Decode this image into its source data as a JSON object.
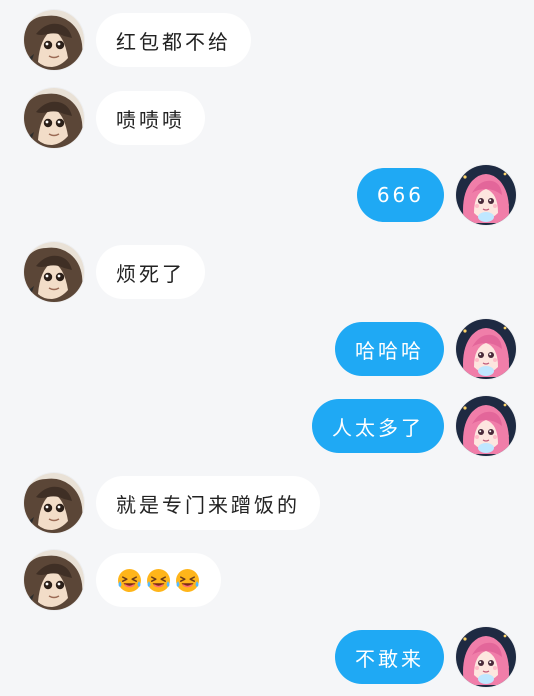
{
  "messages": [
    {
      "side": "left",
      "text": "红包都不给",
      "avatar": "avatar-male"
    },
    {
      "side": "left",
      "text": "啧啧啧",
      "avatar": "avatar-male"
    },
    {
      "side": "right",
      "text": "666",
      "avatar": "avatar-female"
    },
    {
      "side": "left",
      "text": "烦死了",
      "avatar": "avatar-male"
    },
    {
      "side": "right",
      "text": "哈哈哈",
      "avatar": "avatar-female"
    },
    {
      "side": "right",
      "text": "人太多了",
      "avatar": "avatar-female"
    },
    {
      "side": "left",
      "text": "就是专门来蹭饭的",
      "avatar": "avatar-male"
    },
    {
      "side": "left",
      "emoji": [
        "laughing-crying-face-icon",
        "laughing-crying-face-icon",
        "laughing-crying-face-icon"
      ],
      "avatar": "avatar-male"
    },
    {
      "side": "right",
      "text": "不敢来",
      "avatar": "avatar-female"
    }
  ],
  "colors": {
    "background": "#f5f6f8",
    "left_bubble": "#ffffff",
    "right_bubble": "#1fa9f4",
    "left_text": "#222222",
    "right_text": "#ffffff"
  }
}
